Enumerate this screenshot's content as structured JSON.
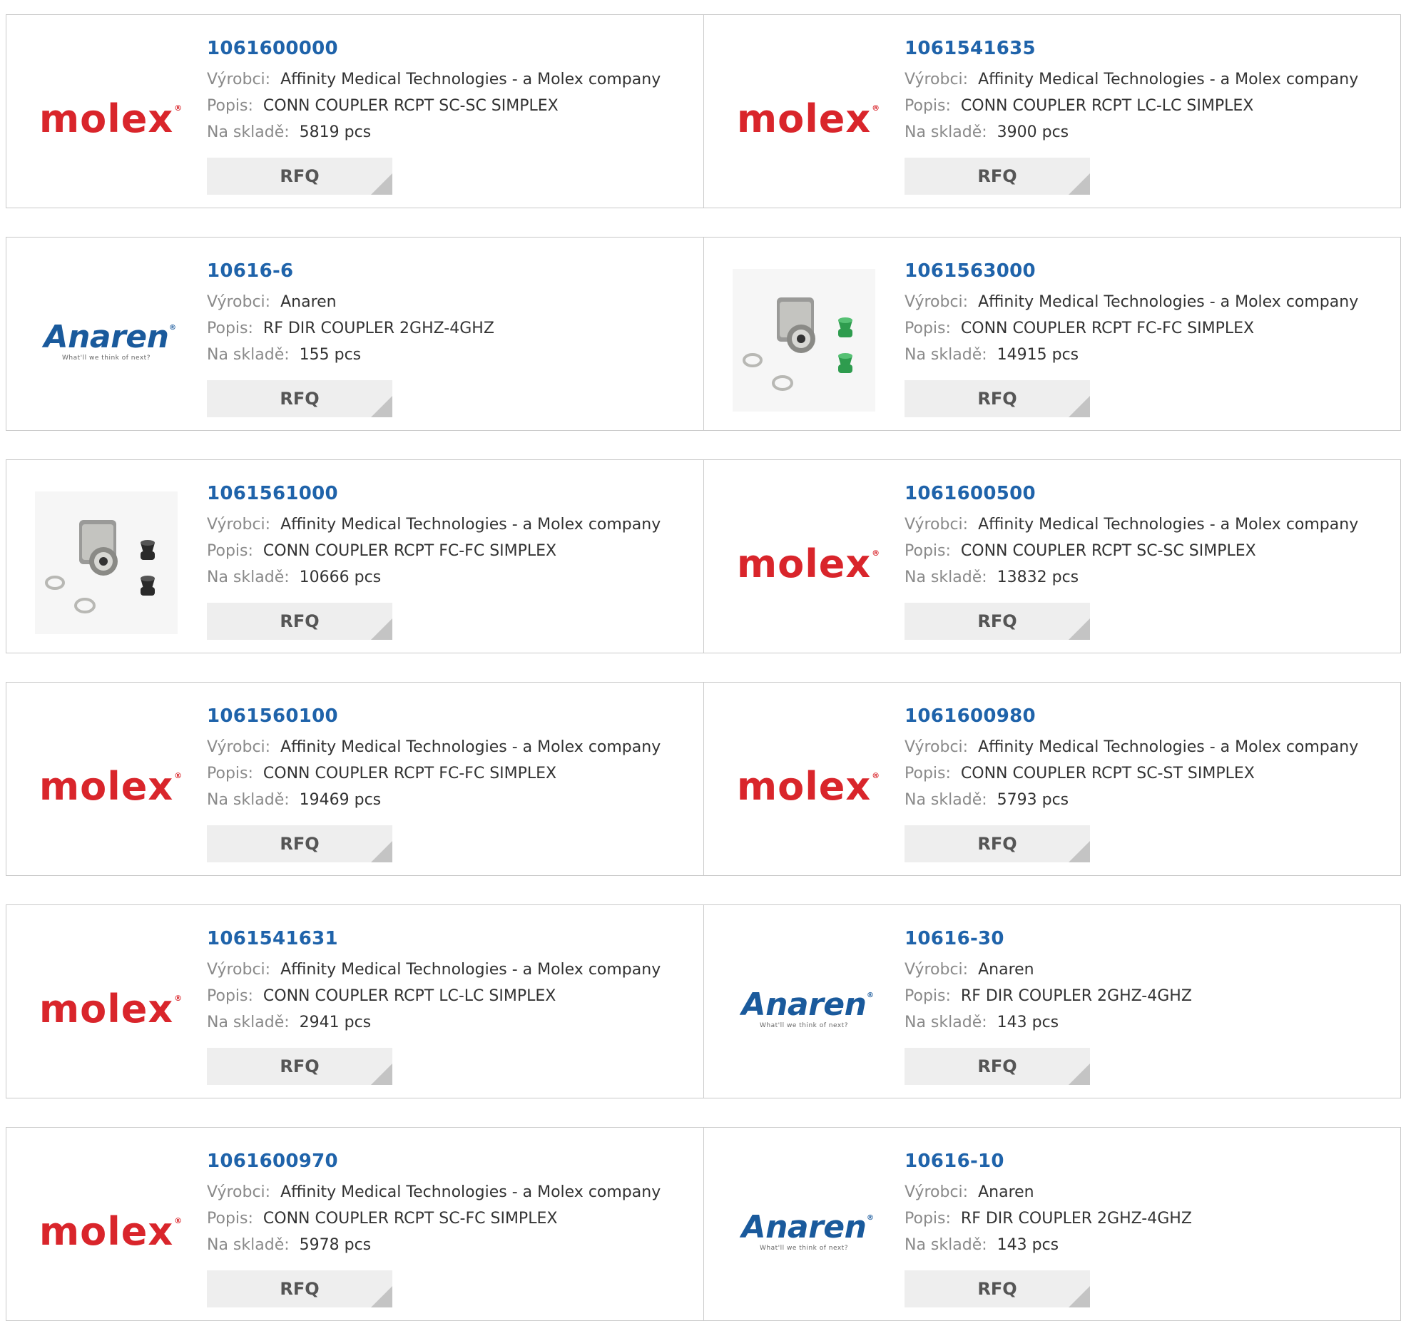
{
  "labels": {
    "manufacturer": "Výrobci:",
    "description": "Popis:",
    "stock": "Na skladě:",
    "rfq": "RFQ"
  },
  "rows": [
    [
      {
        "pn": "1061600000",
        "manufacturer": "Affinity Medical Technologies - a Molex company",
        "description": "CONN COUPLER RCPT SC-SC SIMPLEX",
        "stock": "5819 pcs",
        "image": "molex-logo"
      },
      {
        "pn": "1061541635",
        "manufacturer": "Affinity Medical Technologies - a Molex company",
        "description": "CONN COUPLER RCPT LC-LC SIMPLEX",
        "stock": "3900 pcs",
        "image": "molex-logo"
      }
    ],
    [
      {
        "pn": "10616-6",
        "manufacturer": "Anaren",
        "description": "RF DIR COUPLER 2GHZ-4GHZ",
        "stock": "155 pcs",
        "image": "anaren-logo"
      },
      {
        "pn": "1061563000",
        "manufacturer": "Affinity Medical Technologies - a Molex company",
        "description": "CONN COUPLER RCPT FC-FC SIMPLEX",
        "stock": "14915 pcs",
        "image": "coupler-photo-green-caps"
      }
    ],
    [
      {
        "pn": "1061561000",
        "manufacturer": "Affinity Medical Technologies - a Molex company",
        "description": "CONN COUPLER RCPT FC-FC SIMPLEX",
        "stock": "10666 pcs",
        "image": "coupler-photo-black-caps"
      },
      {
        "pn": "1061600500",
        "manufacturer": "Affinity Medical Technologies - a Molex company",
        "description": "CONN COUPLER RCPT SC-SC SIMPLEX",
        "stock": "13832 pcs",
        "image": "molex-logo"
      }
    ],
    [
      {
        "pn": "1061560100",
        "manufacturer": "Affinity Medical Technologies - a Molex company",
        "description": "CONN COUPLER RCPT FC-FC SIMPLEX",
        "stock": "19469 pcs",
        "image": "molex-logo"
      },
      {
        "pn": "1061600980",
        "manufacturer": "Affinity Medical Technologies - a Molex company",
        "description": "CONN COUPLER RCPT SC-ST SIMPLEX",
        "stock": "5793 pcs",
        "image": "molex-logo"
      }
    ],
    [
      {
        "pn": "1061541631",
        "manufacturer": "Affinity Medical Technologies - a Molex company",
        "description": "CONN COUPLER RCPT LC-LC SIMPLEX",
        "stock": "2941 pcs",
        "image": "molex-logo"
      },
      {
        "pn": "10616-30",
        "manufacturer": "Anaren",
        "description": "RF DIR COUPLER 2GHZ-4GHZ",
        "stock": "143 pcs",
        "image": "anaren-logo"
      }
    ],
    [
      {
        "pn": "1061600970",
        "manufacturer": "Affinity Medical Technologies - a Molex company",
        "description": "CONN COUPLER RCPT SC-FC SIMPLEX",
        "stock": "5978 pcs",
        "image": "molex-logo"
      },
      {
        "pn": "10616-10",
        "manufacturer": "Anaren",
        "description": "RF DIR COUPLER 2GHZ-4GHZ",
        "stock": "143 pcs",
        "image": "anaren-logo"
      }
    ]
  ],
  "logos": {
    "molex": {
      "word": "molex",
      "reg": "®"
    },
    "anaren": {
      "word": "Anaren",
      "reg": "®",
      "tagline": "What'll we think of next?"
    }
  },
  "colors": {
    "part_number": "#1f63aa",
    "molex_red": "#d9252b",
    "anaren_blue": "#1a5a9c",
    "rfq_bg": "#eeeeee",
    "border": "#c9c9c9"
  }
}
